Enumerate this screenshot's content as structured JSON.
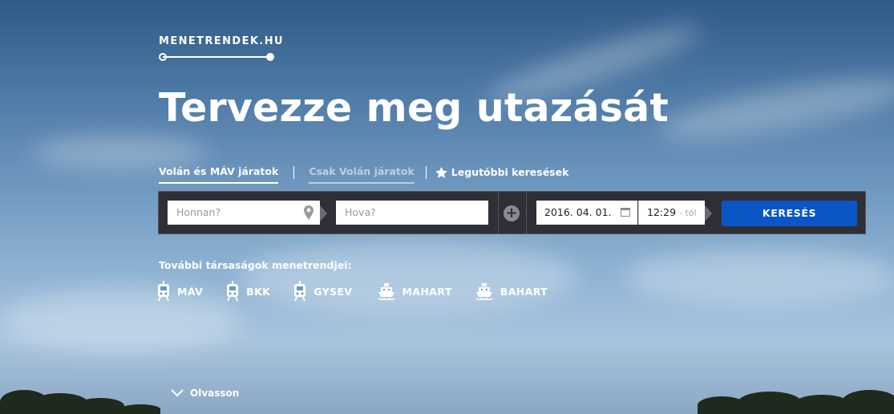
{
  "logo": {
    "text": "MENETRENDEK.HU"
  },
  "headline": "Tervezze meg utazását",
  "tabs": {
    "volan_mav": "Volán és MÁV járatok",
    "csak_volan": "Csak Volán járatok",
    "recent": "Legutóbbi keresések"
  },
  "search": {
    "from_placeholder": "Honnan?",
    "to_placeholder": "Hova?",
    "date": "2016. 04. 01.",
    "time": "12:29",
    "time_suffix": "- tól",
    "button": "KERESÉS"
  },
  "other": {
    "title": "További társaságok menetrendjei:",
    "companies": [
      {
        "label": "MÁV",
        "icon": "train-icon"
      },
      {
        "label": "BKK",
        "icon": "train-icon"
      },
      {
        "label": "GYSEV",
        "icon": "train-icon"
      },
      {
        "label": "MAHART",
        "icon": "ship-icon"
      },
      {
        "label": "BAHART",
        "icon": "ship-icon"
      }
    ]
  },
  "footer": {
    "read_more": "Olvasson"
  },
  "colors": {
    "search_button": "#0b56c6",
    "search_bar_bg": "#2f2f37"
  }
}
